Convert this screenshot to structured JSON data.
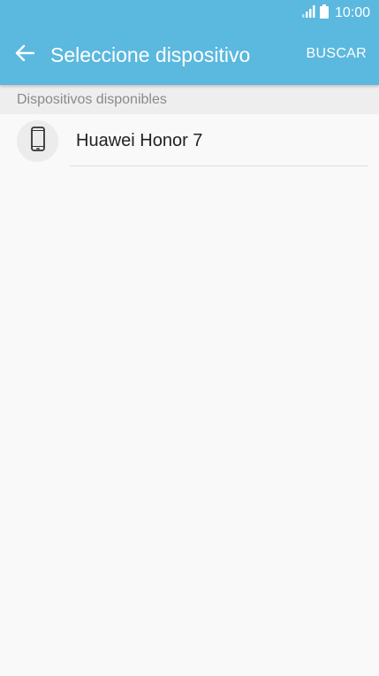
{
  "status_bar": {
    "time": "10:00",
    "signal_icon": "signal-icon",
    "battery_icon": "battery-icon"
  },
  "toolbar": {
    "back_icon": "back-arrow-icon",
    "title": "Seleccione dispositivo",
    "search_label": "BUSCAR"
  },
  "section": {
    "header": "Dispositivos disponibles"
  },
  "devices": [
    {
      "name": "Huawei Honor 7",
      "icon": "phone-icon"
    }
  ],
  "colors": {
    "appbar": "#5bb8de",
    "background": "#f9f9f9",
    "section_header_bg": "#eeeeee",
    "section_header_text": "#8a8a8a"
  }
}
